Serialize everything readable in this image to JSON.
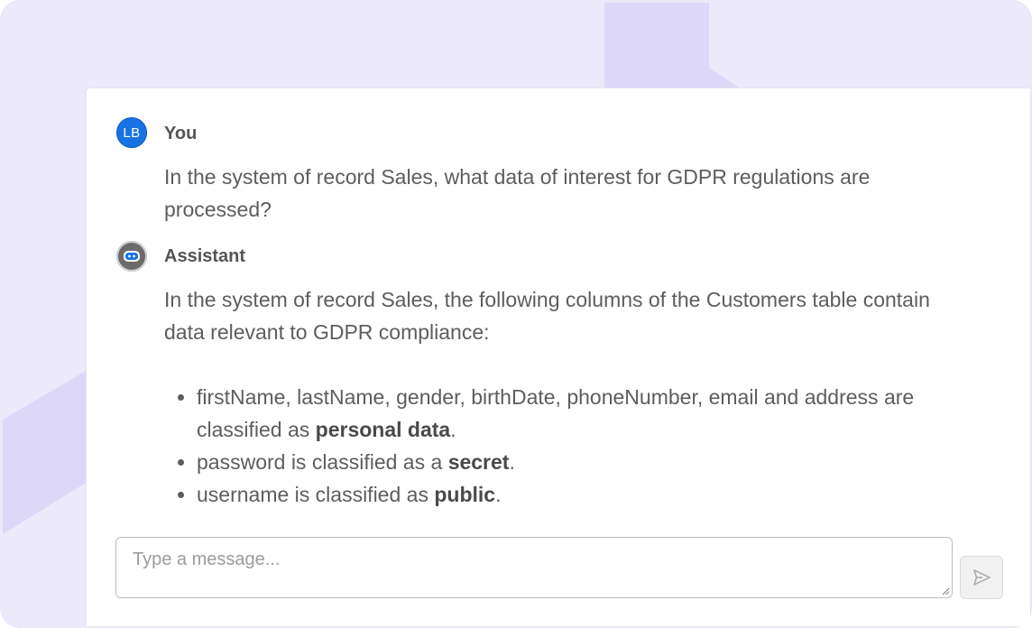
{
  "conversation": {
    "user_message": {
      "avatar_initials": "LB",
      "sender": "You",
      "text": "In the system of record Sales, what data of interest for GDPR regulations are processed?"
    },
    "assistant_message": {
      "avatar_icon": "robot-icon",
      "sender": "Assistant",
      "intro": "In the system of record Sales, the following columns of the Customers table contain data relevant to GDPR compliance:",
      "bullets": [
        {
          "text": "firstName, lastName, gender, birthDate, phoneNumber, email and address are classified as ",
          "emphasis": "personal data",
          "suffix": "."
        },
        {
          "text": "password is classified as a ",
          "emphasis": "secret",
          "suffix": "."
        },
        {
          "text": "username is classified as ",
          "emphasis": "public",
          "suffix": "."
        }
      ]
    }
  },
  "composer": {
    "placeholder": "Type a message...",
    "value": "",
    "send_icon": "send-icon"
  },
  "colors": {
    "background": "#ece9fb",
    "decoration": "#ddd7f8",
    "user_avatar": "#1773e3",
    "bot_avatar": "#6b6b6b"
  }
}
